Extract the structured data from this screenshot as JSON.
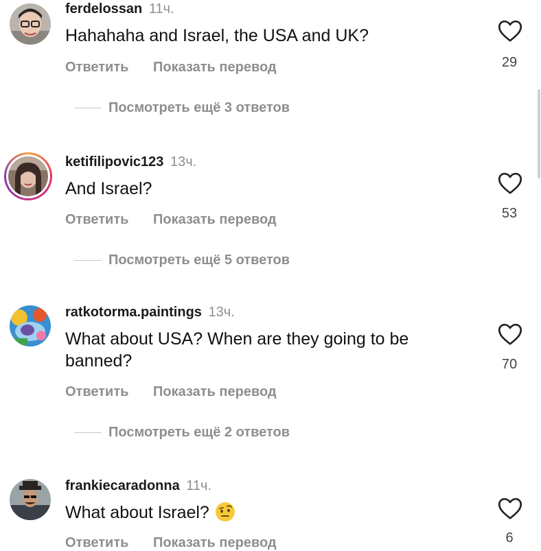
{
  "comments": [
    {
      "username": "ferdelossan",
      "time": "11ч.",
      "text": "Hahahaha and Israel, the USA and UK?",
      "reply": "Ответить",
      "translate": "Показать перевод",
      "more": "Посмотреть ещё 3 ответов",
      "likes": "29"
    },
    {
      "username": "ketifilipovic123",
      "time": "13ч.",
      "text": "And Israel?",
      "reply": "Ответить",
      "translate": "Показать перевод",
      "more": "Посмотреть ещё 5 ответов",
      "likes": "53"
    },
    {
      "username": "ratkotorma.paintings",
      "time": "13ч.",
      "text_line1": "What about USA?  When are they going to be",
      "text_line2": "banned?",
      "reply": "Ответить",
      "translate": "Показать перевод",
      "more": "Посмотреть ещё 2 ответов",
      "likes": "70"
    },
    {
      "username": "frankiecaradonna",
      "time": "11ч.",
      "text": "What about Israel?",
      "emoji": "face-with-raised-eyebrow",
      "reply": "Ответить",
      "translate": "Показать перевод",
      "likes": "6"
    }
  ],
  "icons": {
    "like": "heart-outline-icon"
  },
  "colors": {
    "muted": "#8e8e8e",
    "text": "#111111",
    "story_ring": [
      "#f9a03f",
      "#e1306c",
      "#833ab4"
    ]
  }
}
